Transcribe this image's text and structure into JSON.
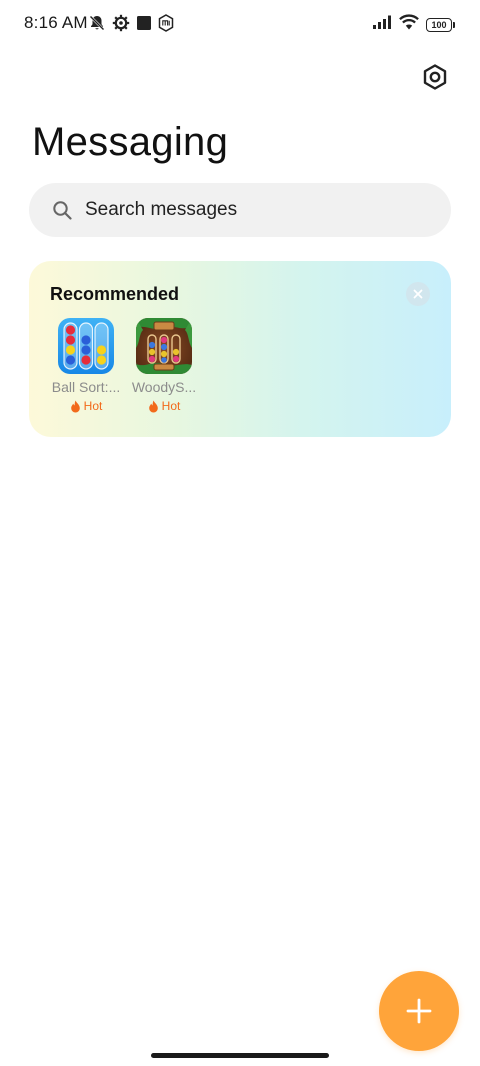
{
  "status_bar": {
    "time": "8:16 AM",
    "battery": "100",
    "icons": [
      "notifications-off-icon",
      "settings-gear-icon",
      "square-icon",
      "mi-icon",
      "signal-icon",
      "wifi-icon",
      "battery-icon"
    ]
  },
  "header": {
    "title": "Messaging",
    "settings_icon": "settings-icon"
  },
  "search": {
    "placeholder": "Search messages",
    "value": ""
  },
  "recommended": {
    "title": "Recommended",
    "close_icon": "close-icon",
    "apps": [
      {
        "name": "Ball Sort:...",
        "badge": "Hot",
        "icon": "ball-sort-app-icon"
      },
      {
        "name": "WoodyS...",
        "badge": "Hot",
        "icon": "woody-sort-app-icon"
      }
    ]
  },
  "fab": {
    "icon": "plus-icon"
  },
  "colors": {
    "accent": "#ffa43a",
    "hot": "#f26a1b",
    "search_bg": "#f1f1f1"
  }
}
